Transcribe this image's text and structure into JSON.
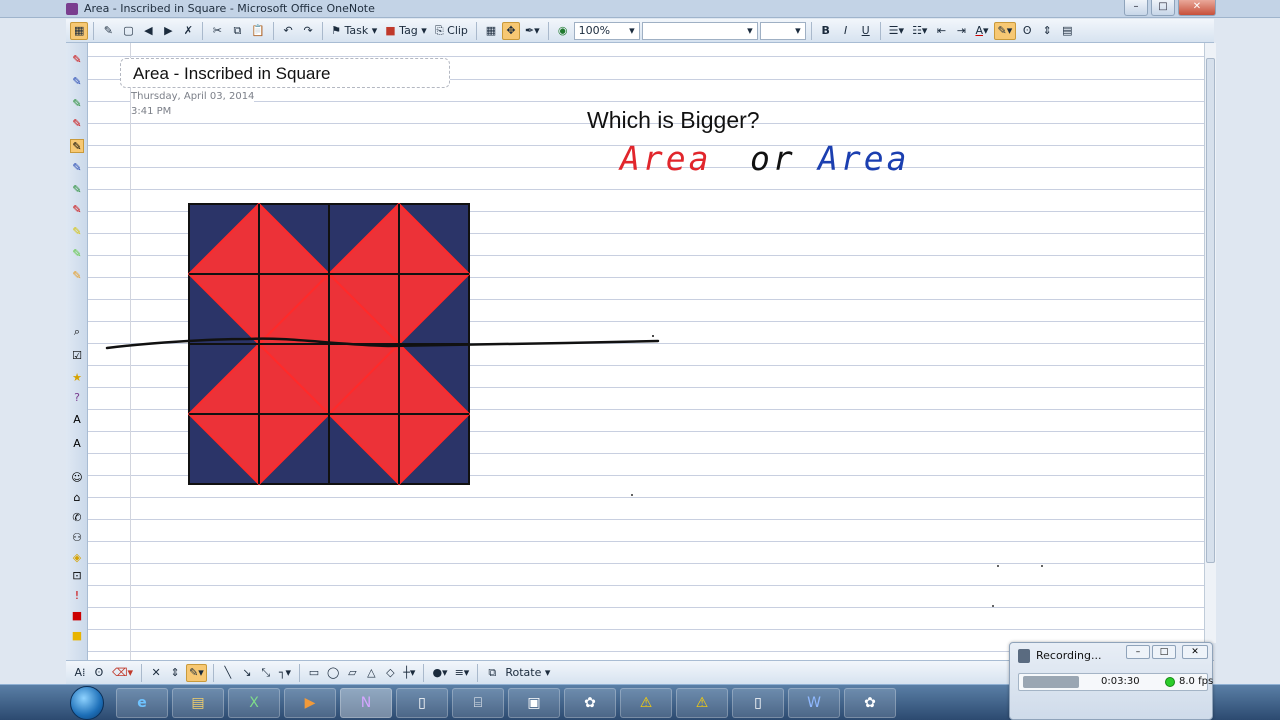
{
  "window": {
    "title": "Area - Inscribed in Square - Microsoft Office OneNote",
    "buttons": [
      "–",
      "□",
      "✕"
    ]
  },
  "toolbar": {
    "task_label": "Task",
    "tag_label": "Tag",
    "clip_label": "Clip",
    "zoom_value": "100%",
    "font_value": "",
    "size_value": "",
    "bold": "B",
    "italic": "I",
    "underline": "U",
    "font_color": "A"
  },
  "page": {
    "title": "Area - Inscribed in Square",
    "date": "Thursday, April 03, 2014",
    "time": "3:41 PM",
    "question": "Which is Bigger?",
    "ink": {
      "area_red": "Area",
      "or": "or",
      "area_blue": "Area"
    }
  },
  "drawbar": {
    "rotate_label": "Rotate"
  },
  "recorder": {
    "title": "Recording...",
    "elapsed": "0:03:30",
    "fps": "8.0 fps"
  },
  "colors": {
    "square_navy": "#2b3468",
    "triangle_red": "#ec3238",
    "ink_red": "#e1262c",
    "ink_blue": "#1b3fb0",
    "accent_orange": "#f7c873"
  },
  "icons": [
    "onenote-app-icon",
    "pen-icon",
    "undo-icon",
    "redo-icon",
    "flag-icon",
    "table-icon",
    "search-icon",
    "chevron-down-icon",
    "cursor-icon",
    "lasso-icon",
    "eraser-icon",
    "line-icon",
    "rectangle-icon",
    "ellipse-icon",
    "triangle-icon",
    "diamond-icon",
    "start-orb-icon",
    "ie-icon",
    "excel-icon",
    "word-icon",
    "warning-icon"
  ]
}
